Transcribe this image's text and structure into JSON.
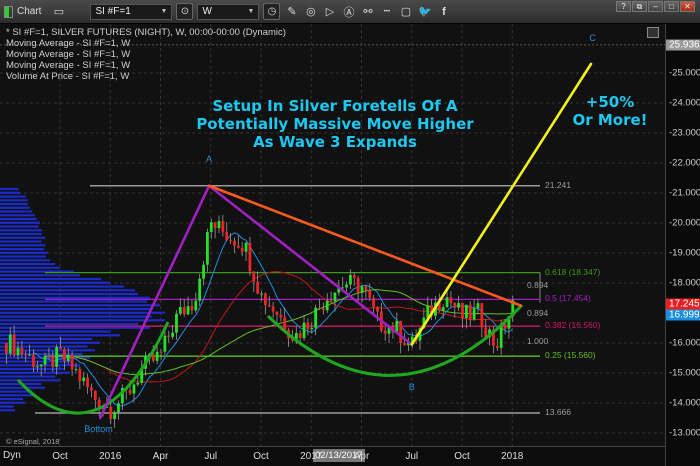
{
  "toolbar": {
    "title": "Chart",
    "symbol": "SI #F=1",
    "interval": "W",
    "window_buttons": [
      "?",
      "⧉",
      "–",
      "□",
      "✕"
    ]
  },
  "legend": [
    "* SI #F=1, SILVER FUTURES (NIGHT), W, 00:00-00:00 (Dynamic)",
    "Moving Average - SI #F=1, W",
    "Moving Average - SI #F=1, W",
    "Moving Average - SI #F=1, W",
    "Volume At Price - SI #F=1, W"
  ],
  "headline": {
    "line1": "Setup In Silver Foretells Of A",
    "line2": "Potentially Massive Move Higher",
    "line3": "As Wave 3 Expands",
    "callout1": "+50%",
    "callout2": "Or More!"
  },
  "copyright": "© eSignal, 2018",
  "x_axis": {
    "dyn_label": "Dyn",
    "cursor_date": "02/13/2017",
    "ticks": [
      {
        "label": "Oct",
        "m": 0
      },
      {
        "label": "2016",
        "m": 3
      },
      {
        "label": "Apr",
        "m": 6
      },
      {
        "label": "Jul",
        "m": 9
      },
      {
        "label": "Oct",
        "m": 12
      },
      {
        "label": "2017",
        "m": 15
      },
      {
        "label": "Apr",
        "m": 18
      },
      {
        "label": "Jul",
        "m": 21
      },
      {
        "label": "Oct",
        "m": 24
      },
      {
        "label": "2018",
        "m": 27
      }
    ]
  },
  "y_axis": {
    "ticks": [
      "25.000",
      "24.000",
      "23.000",
      "22.000",
      "21.000",
      "20.000",
      "19.000",
      "18.000",
      "16.000",
      "15.000",
      "14.000",
      "13.000"
    ],
    "price_tags": [
      {
        "label": "25.936",
        "value": 25.936,
        "color": "#9a9a9a"
      },
      {
        "label": "17.245",
        "value": 17.3,
        "color": "#e82020"
      },
      {
        "label": "16.999",
        "value": 16.95,
        "color": "#1a8fe0"
      }
    ]
  },
  "chart_data": {
    "type": "candlestick",
    "title": "SI #F=1, SILVER FUTURES (NIGHT), W",
    "ylim": [
      12.6,
      26.6
    ],
    "x_unit": "months since Oct 2015",
    "monthly_close": {
      "start_m": -3,
      "values": [
        16.0,
        15.6,
        15.2,
        15.6,
        15.0,
        14.2,
        13.8,
        14.3,
        15.2,
        15.6,
        16.9,
        17.4,
        20.0,
        19.6,
        19.3,
        17.6,
        17.0,
        16.2,
        16.8,
        17.6,
        18.0,
        17.9,
        16.7,
        16.5,
        15.9,
        17.0,
        17.6,
        16.9,
        17.0,
        15.9,
        17.2
      ]
    },
    "moving_averages": [
      {
        "name": "short",
        "period": 8,
        "color": "#1a8fe0"
      },
      {
        "name": "medium",
        "period": 26,
        "color": "#c01818"
      },
      {
        "name": "long",
        "period": 52,
        "color": "#5fc01e"
      }
    ],
    "volume_at_price": {
      "start_price": 13.75,
      "step": 0.25,
      "values": [
        15,
        25,
        35,
        45,
        60,
        70,
        80,
        90,
        95,
        100,
        120,
        150,
        165,
        165,
        160,
        150,
        135,
        110,
        80,
        60,
        50,
        48,
        45,
        45,
        42,
        40,
        35,
        30,
        28,
        20
      ]
    },
    "levels": [
      {
        "label": "21.241",
        "value": 21.241,
        "color": "#9a9a9a"
      },
      {
        "label": "13.666",
        "value": 13.666,
        "color": "#9a9a9a"
      },
      {
        "label": "0.618 (18.347)",
        "value": 18.347,
        "color": "#3a9a1e"
      },
      {
        "label": "0.5 (17.454)",
        "value": 17.454,
        "color": "#a020c0"
      },
      {
        "label": "0.382 (16.560)",
        "value": 16.56,
        "color": "#d0186a"
      },
      {
        "label": "0.25 (15.560)",
        "value": 15.56,
        "color": "#5fc01e"
      }
    ],
    "extension_labels": [
      {
        "label": "0.894",
        "value": 17.9
      },
      {
        "label": "0.894",
        "value": 16.98
      },
      {
        "label": "1.000",
        "value": 16.05
      }
    ],
    "trendlines": [
      {
        "name": "wave-up",
        "color": "#a020c0",
        "points": [
          [
            2.4,
            13.5
          ],
          [
            8.9,
            21.241
          ]
        ]
      },
      {
        "name": "wave-down",
        "color": "#a020c0",
        "points": [
          [
            8.9,
            21.241
          ],
          [
            21.0,
            15.95
          ]
        ]
      },
      {
        "name": "resistance",
        "color": "#ff5a1e",
        "points": [
          [
            8.9,
            21.241
          ],
          [
            27.5,
            17.25
          ]
        ]
      },
      {
        "name": "wave-3-projection",
        "color": "#f2f21a",
        "points": [
          [
            21.0,
            15.95
          ],
          [
            31.7,
            25.3
          ]
        ]
      }
    ],
    "wave_labels": [
      {
        "label": "A",
        "m": 8.9,
        "value": 22.1
      },
      {
        "label": "B",
        "m": 21.0,
        "value": 14.5
      },
      {
        "label": "C",
        "m": 31.8,
        "value": 26.15
      },
      {
        "label": "Bottom",
        "m": 2.3,
        "value": 13.1
      }
    ]
  }
}
